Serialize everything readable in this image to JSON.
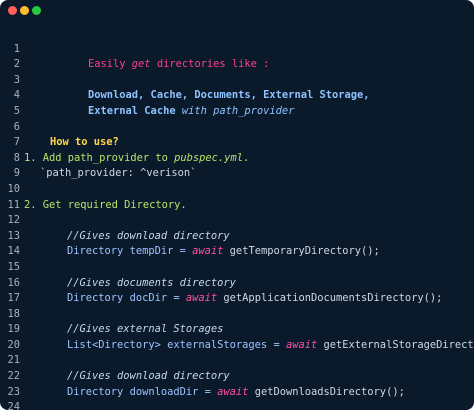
{
  "window_controls": {
    "close_color": "#ff5f56",
    "minimize_color": "#ffbd2e",
    "maximize_color": "#27c93f"
  },
  "code": {
    "line_numbers": [
      "1",
      "2",
      "3",
      "4",
      "5",
      "6",
      "7",
      "8",
      "9",
      "10",
      "11",
      "12",
      "13",
      "14",
      "15",
      "16",
      "17",
      "18",
      "19",
      "20",
      "21",
      "22",
      "23",
      "24"
    ],
    "l1_a": "Easily ",
    "l1_b": "get",
    "l1_c": " directories like :",
    "l3": "Download, Cache, Documents, External Storage,",
    "l4_a": "External Cache ",
    "l4_b": "with path_provider",
    "l6": "How to use?",
    "l7_a": "1. Add path_provider to ",
    "l7_b": "pubspec.yml",
    "l7_c": ".",
    "l8": "`path_provider: ^verison`",
    "l10_a": "2. Get required Directory.",
    "l12": "//Gives download directory",
    "l13_type": "Directory",
    "l13_var": " tempDir = ",
    "l13_kw": "await",
    "l13_fn": " getTemporaryDirectory();",
    "l15": "//Gives documents directory",
    "l16_type": "Directory",
    "l16_var": " docDir = ",
    "l16_kw": "await",
    "l16_fn": " getApplicationDocumentsDirectory();",
    "l18": "//Gives external Storages",
    "l19_type": "List<Directory>",
    "l19_var": " externalStorages = ",
    "l19_kw": "await",
    "l19_fn": " getExternalStorageDirectories();",
    "l21": "//Gives download directory",
    "l22_type": "Directory",
    "l22_var": " downloadDir = ",
    "l22_kw": "await",
    "l22_fn": " getDownloadsDirectory();"
  }
}
